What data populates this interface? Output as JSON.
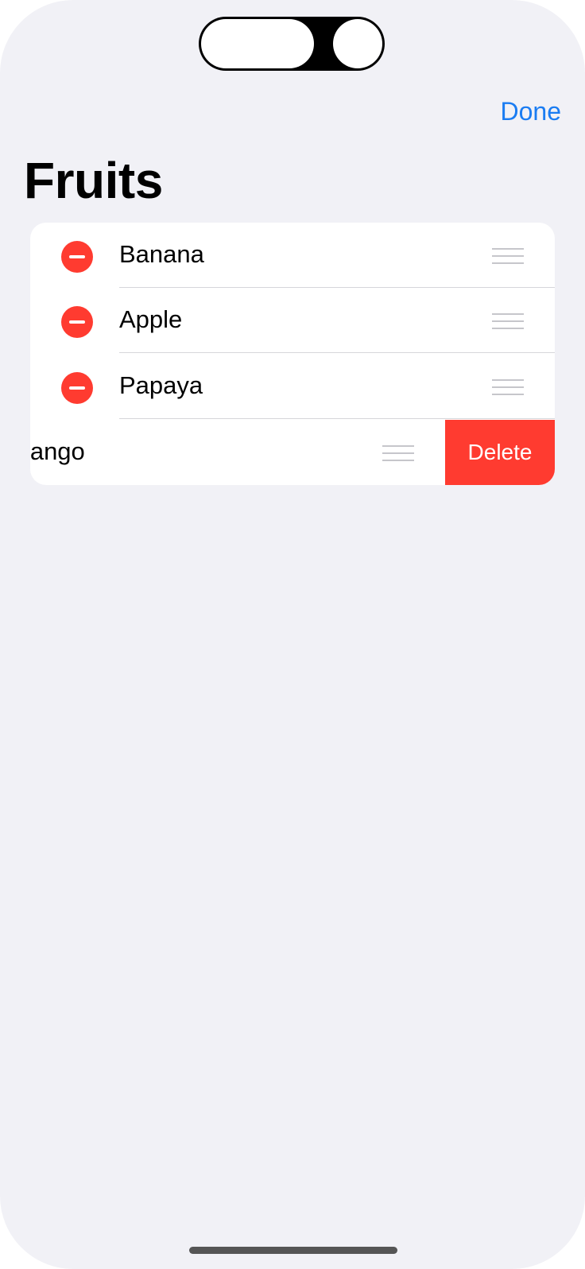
{
  "nav": {
    "done_label": "Done"
  },
  "page": {
    "title": "Fruits"
  },
  "list": {
    "items": [
      {
        "label": "Banana"
      },
      {
        "label": "Apple"
      },
      {
        "label": "Papaya"
      },
      {
        "label": "Mango",
        "swiped": true,
        "action_label": "Delete"
      }
    ]
  },
  "colors": {
    "background": "#f1f1f6",
    "accent": "#1a7cf2",
    "destructive": "#ff3b30",
    "separator": "#d6d6da",
    "grip": "#c6c6cb"
  }
}
